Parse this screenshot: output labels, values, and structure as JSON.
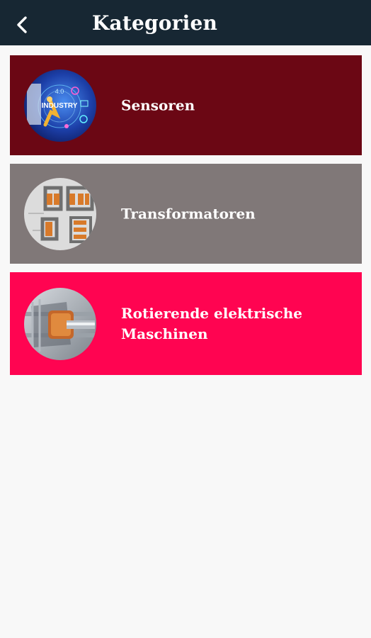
{
  "header": {
    "title": "Kategorien",
    "back_icon": "chevron-left-icon",
    "background": "#172733"
  },
  "categories": [
    {
      "label": "Sensoren",
      "color": "#6b0714",
      "image_icon": "industry-robot-thumbnail",
      "image_text": "INDUSTRY"
    },
    {
      "label": "Transformatoren",
      "color": "#807878",
      "image_icon": "transformer-cores-thumbnail"
    },
    {
      "label": "Rotierende elektrische\nMaschinen",
      "color": "#ff0451",
      "image_icon": "electric-motor-thumbnail"
    }
  ]
}
